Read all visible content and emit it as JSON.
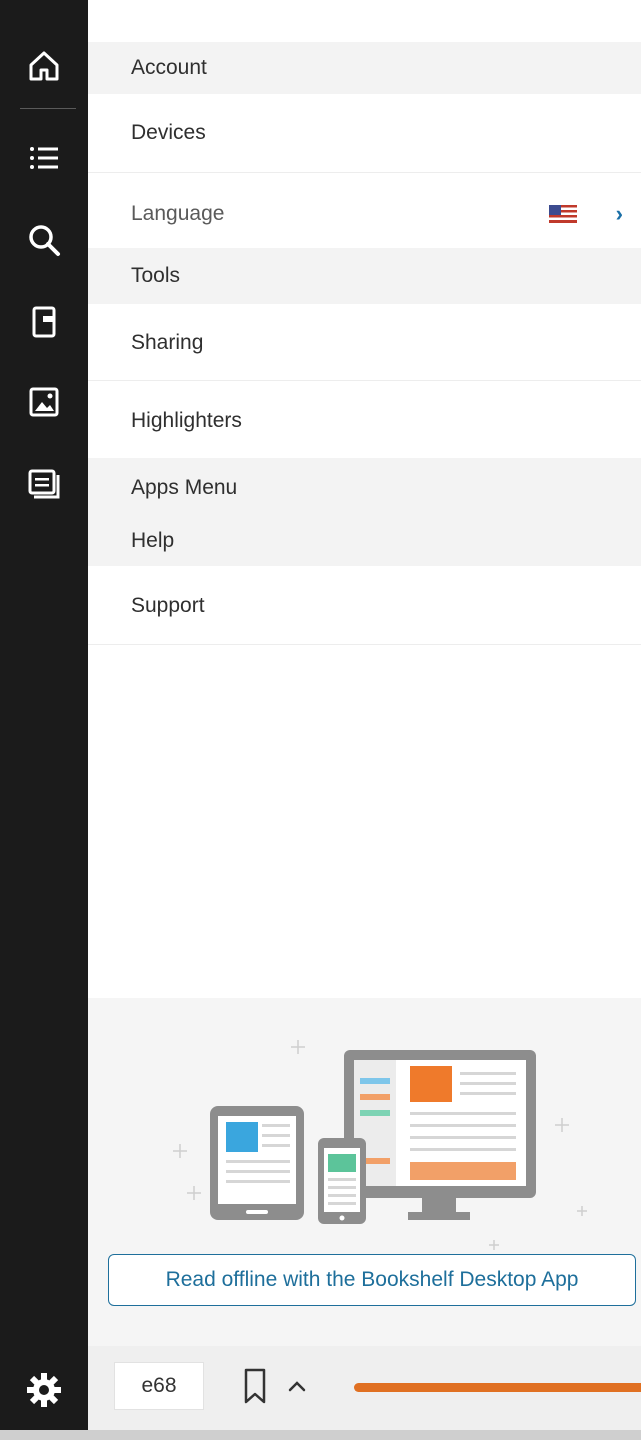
{
  "rail": {
    "icons": [
      "home-icon",
      "table-of-contents-icon",
      "search-icon",
      "bookmark-pages-icon",
      "image-gallery-icon",
      "notes-icon",
      "settings-icon"
    ]
  },
  "menu": {
    "items": [
      {
        "label": "Account"
      },
      {
        "label": "Devices"
      },
      {
        "label": "Language"
      },
      {
        "label": "Tools"
      },
      {
        "label": "Sharing"
      },
      {
        "label": "Highlighters"
      },
      {
        "label": "Apps Menu"
      },
      {
        "label": "Help"
      },
      {
        "label": "Support"
      }
    ],
    "language_flag": "us-flag-icon"
  },
  "promo": {
    "button_label": "Read offline with the Bookshelf Desktop App"
  },
  "bottombar": {
    "page_value": "e68"
  },
  "colors": {
    "rail": "#1b1b1b",
    "accent": "#1e6f9b",
    "progress": "#e07022"
  }
}
